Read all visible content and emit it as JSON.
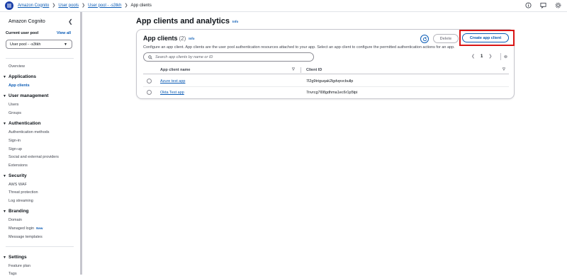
{
  "breadcrumb": {
    "items": [
      "Amazon Cognito",
      "User pools",
      "User pool - -s3tkh"
    ],
    "current": "App clients"
  },
  "sidebar": {
    "title": "Amazon Cognito",
    "current_pool_label": "Current user pool",
    "view_all": "View all",
    "pool_select_value": "User pool - -s3tkh",
    "overview": "Overview",
    "sections": [
      {
        "heading": "Applications",
        "items": [
          "App clients"
        ]
      },
      {
        "heading": "User management",
        "items": [
          "Users",
          "Groups"
        ]
      },
      {
        "heading": "Authentication",
        "items": [
          "Authentication methods",
          "Sign-in",
          "Sign-up",
          "Social and external providers",
          "Extensions"
        ]
      },
      {
        "heading": "Security",
        "items": [
          "AWS WAF",
          "Threat protection",
          "Log streaming"
        ]
      },
      {
        "heading": "Branding",
        "items": [
          "Domain",
          "Managed login",
          "Message templates"
        ]
      },
      {
        "heading": "Settings",
        "items": [
          "Feature plan",
          "Tags"
        ]
      }
    ],
    "new_badge": "New"
  },
  "main": {
    "page_title": "App clients and analytics",
    "info_label": "Info",
    "card": {
      "title": "App clients",
      "count": "(2)",
      "info_label": "Info",
      "description": "Configure an app client. App clients are the user pool authentication resources attached to your app. Select an app client to configure the permitted authentication actions for an app.",
      "delete_label": "Delete",
      "create_label": "Create app client",
      "search_placeholder": "Search app clients by name or ID",
      "page_number": "1",
      "columns": [
        "App client name",
        "Client ID"
      ],
      "rows": [
        {
          "name": "Azure test app",
          "client_id": "7l2g9triguqak2lgdvpvcbullp"
        },
        {
          "name": "Okta Test app",
          "client_id": "7nvrcg7l08gdhma1ec6r1p5tpi"
        }
      ]
    }
  },
  "colors": {
    "link": "#0a5bb5",
    "highlight": "#d91515"
  }
}
